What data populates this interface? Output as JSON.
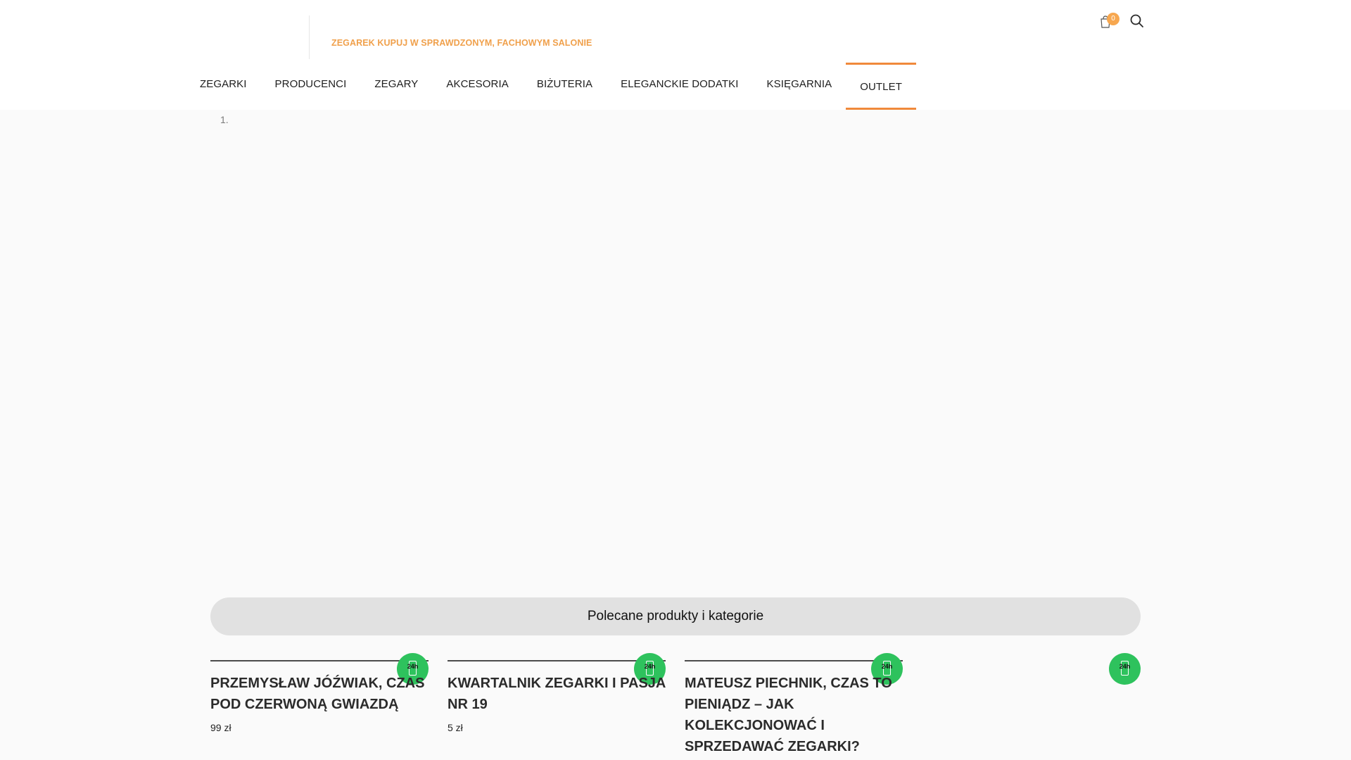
{
  "header": {
    "tagline": "ZEGAREK KUPUJ W SPRAWDZONYM, FACHOWYM SALONIE",
    "cart": {
      "count": "0",
      "icon": "cart-icon"
    },
    "search": {
      "icon": "search-icon"
    }
  },
  "nav": {
    "items": [
      {
        "label": "ZEGARKI"
      },
      {
        "label": "PRODUCENCI"
      },
      {
        "label": "ZEGARY"
      },
      {
        "label": "AKCESORIA"
      },
      {
        "label": "BIŻUTERIA"
      },
      {
        "label": "ELEGANCKIE DODATKI"
      },
      {
        "label": "KSIĘGARNIA"
      },
      {
        "label": "OUTLET",
        "active": true
      }
    ]
  },
  "breadcrumb": {
    "marker": "1."
  },
  "recommended": {
    "title": "Polecane produkty i kategorie"
  },
  "products": [
    {
      "title": "PRZEMYSŁAW JÓŹWIAK, CZAS POD CZERWONĄ GWIAZDĄ",
      "price": "99 zł",
      "badge": "24h"
    },
    {
      "title": "KWARTALNIK ZEGARKI I PASJA NR 19",
      "price": "5 zł",
      "badge": "24h"
    },
    {
      "title": "MATEUSZ PIECHNIK, CZAS TO PIENIĄDZ – JAK KOLEKCJONOWAĆ I SPRZEDAWAĆ ZEGARKI?",
      "price": "",
      "badge": "24h"
    },
    {
      "title": "",
      "price": "",
      "badge": "24h"
    }
  ],
  "colors": {
    "accent": "#f0893b",
    "tagline": "#f0a04b",
    "badge_green": "#2ec25d",
    "page_bg": "#fafafa"
  }
}
